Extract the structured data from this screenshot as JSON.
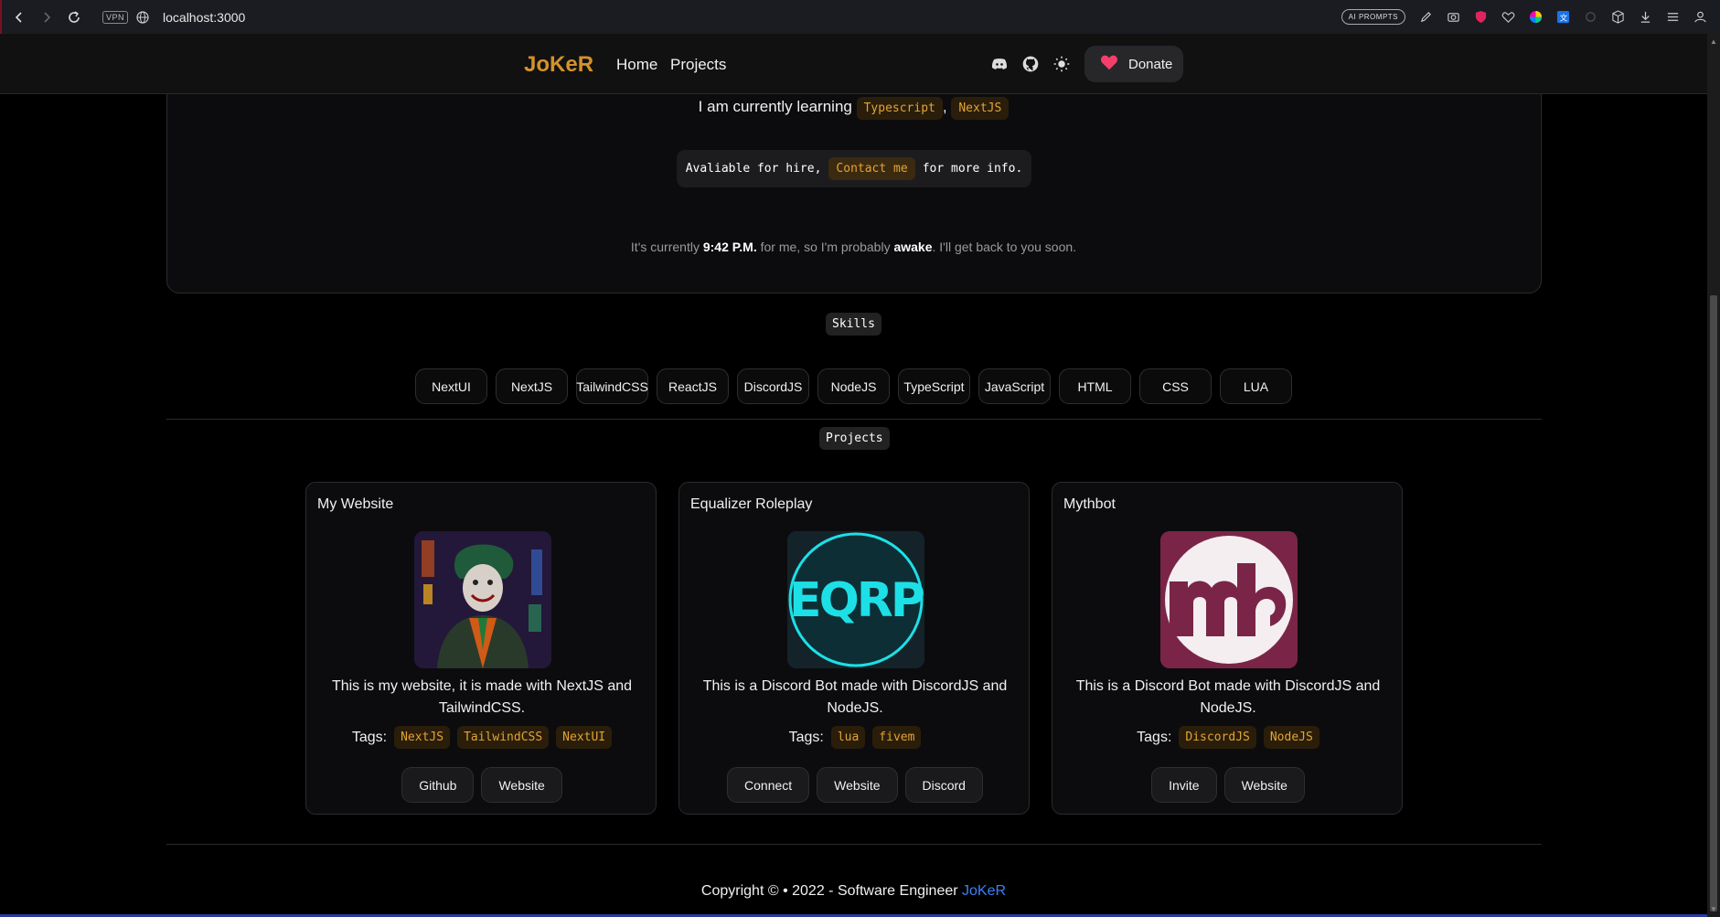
{
  "browser": {
    "url": "localhost:3000",
    "vpn_label": "VPN",
    "ai_prompts_label": "AI PROMPTS"
  },
  "header": {
    "logo": "JoKeR",
    "nav": [
      "Home",
      "Projects"
    ],
    "donate_label": "Donate"
  },
  "intro": {
    "learning_prefix": "I am currently learning",
    "learning_tags": [
      "Typescript",
      "NextJS"
    ],
    "learning_sep": ",",
    "hire_prefix": "Avaliable for hire,",
    "hire_link": "Contact me",
    "hire_suffix": "for more info.",
    "time_prefix": "It's currently",
    "time_value": "9:42 P.M.",
    "time_mid": "for me, so I'm probably",
    "time_state": "awake",
    "time_suffix": ". I'll get back to you soon."
  },
  "skills": {
    "label": "Skills",
    "items": [
      "NextUI",
      "NextJS",
      "TailwindCSS",
      "ReactJS",
      "DiscordJS",
      "NodeJS",
      "TypeScript",
      "JavaScript",
      "HTML",
      "CSS",
      "LUA"
    ]
  },
  "projects": {
    "label": "Projects",
    "tags_label": "Tags:",
    "items": [
      {
        "title": "My Website",
        "description": "This is my website, it is made with NextJS and TailwindCSS.",
        "tags": [
          "NextJS",
          "TailwindCSS",
          "NextUI"
        ],
        "buttons": [
          "Github",
          "Website"
        ]
      },
      {
        "title": "Equalizer Roleplay",
        "image_text": "EQRP",
        "description": "This is a Discord Bot made with DiscordJS and NodeJS.",
        "tags": [
          "lua",
          "fivem"
        ],
        "buttons": [
          "Connect",
          "Website",
          "Discord"
        ]
      },
      {
        "title": "Mythbot",
        "description": "This is a Discord Bot made with DiscordJS and NodeJS.",
        "tags": [
          "DiscordJS",
          "NodeJS"
        ],
        "buttons": [
          "Invite",
          "Website"
        ]
      }
    ]
  },
  "footer": {
    "text": "Copyright © • 2022 - Software Engineer",
    "brand": "JoKeR"
  },
  "colors": {
    "accent": "#d4922a",
    "tag_text": "#e3a336",
    "link_blue": "#3b82f6",
    "background": "#000000"
  }
}
